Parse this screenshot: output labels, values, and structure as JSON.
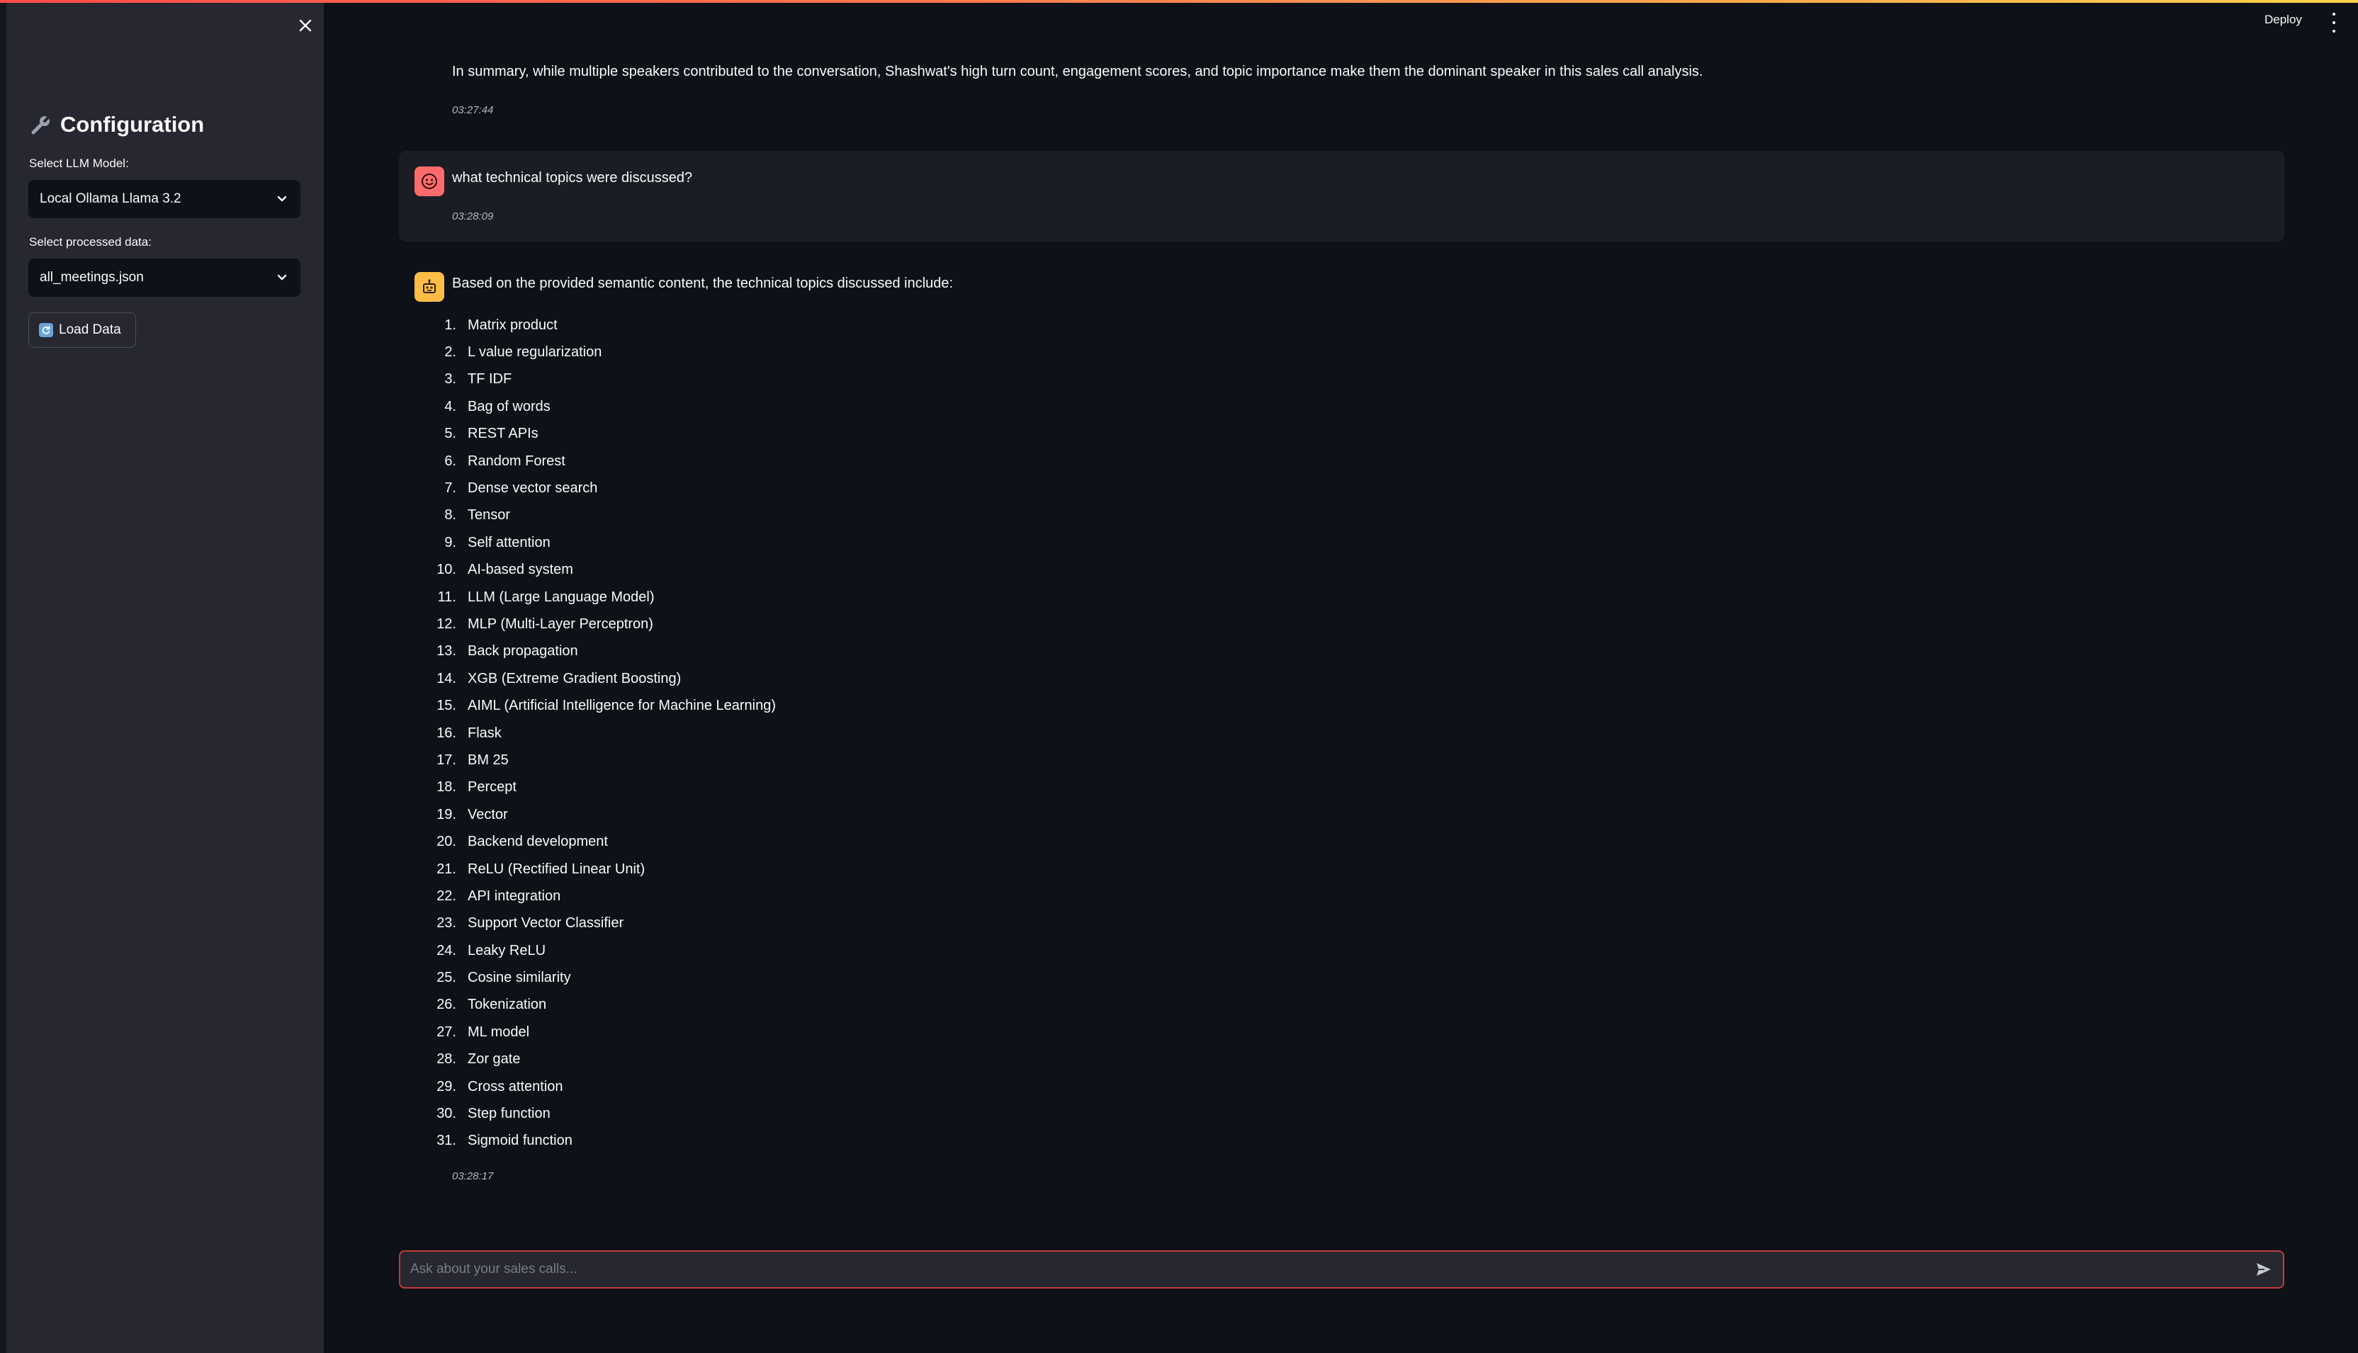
{
  "header": {
    "deploy_label": "Deploy",
    "menu_icon": "kebab-menu-icon"
  },
  "sidebar": {
    "close_icon": "close-icon",
    "title": "Configuration",
    "title_icon": "wrench-icon",
    "model_label": "Select LLM Model:",
    "model_value": "Local Ollama Llama 3.2",
    "data_label": "Select processed data:",
    "data_value": "all_meetings.json",
    "load_button_label": "Load Data",
    "load_button_icon": "refresh-icon"
  },
  "chat": {
    "previous_message": {
      "text": "In summary, while multiple speakers contributed to the conversation, Shashwat's high turn count, engagement scores, and topic importance make them the dominant speaker in this sales call analysis.",
      "time": "03:27:44"
    },
    "user_message": {
      "text": "what technical topics were discussed?",
      "time": "03:28:09",
      "avatar_icon": "user-face-icon"
    },
    "assistant_message": {
      "intro": "Based on the provided semantic content, the technical topics discussed include:",
      "avatar_icon": "robot-icon",
      "time": "03:28:17",
      "topics": [
        "Matrix product",
        "L value regularization",
        "TF IDF",
        "Bag of words",
        "REST APIs",
        "Random Forest",
        "Dense vector search",
        "Tensor",
        "Self attention",
        "AI-based system",
        "LLM (Large Language Model)",
        "MLP (Multi-Layer Perceptron)",
        "Back propagation",
        "XGB (Extreme Gradient Boosting)",
        "AIML (Artificial Intelligence for Machine Learning)",
        "Flask",
        "BM 25",
        "Percept",
        "Vector",
        "Backend development",
        "ReLU (Rectified Linear Unit)",
        "API integration",
        "Support Vector Classifier",
        "Leaky ReLU",
        "Cosine similarity",
        "Tokenization",
        "ML model",
        "Zor gate",
        "Cross attention",
        "Step function",
        "Sigmoid function"
      ]
    },
    "input": {
      "placeholder": "Ask about your sales calls...",
      "value": "",
      "send_icon": "send-icon"
    }
  },
  "colors": {
    "background": "#0e1117",
    "sidebar": "#262730",
    "accent": "#ff4b4b",
    "user_avatar": "#ff6b6b",
    "bot_avatar": "#ffbd45"
  }
}
